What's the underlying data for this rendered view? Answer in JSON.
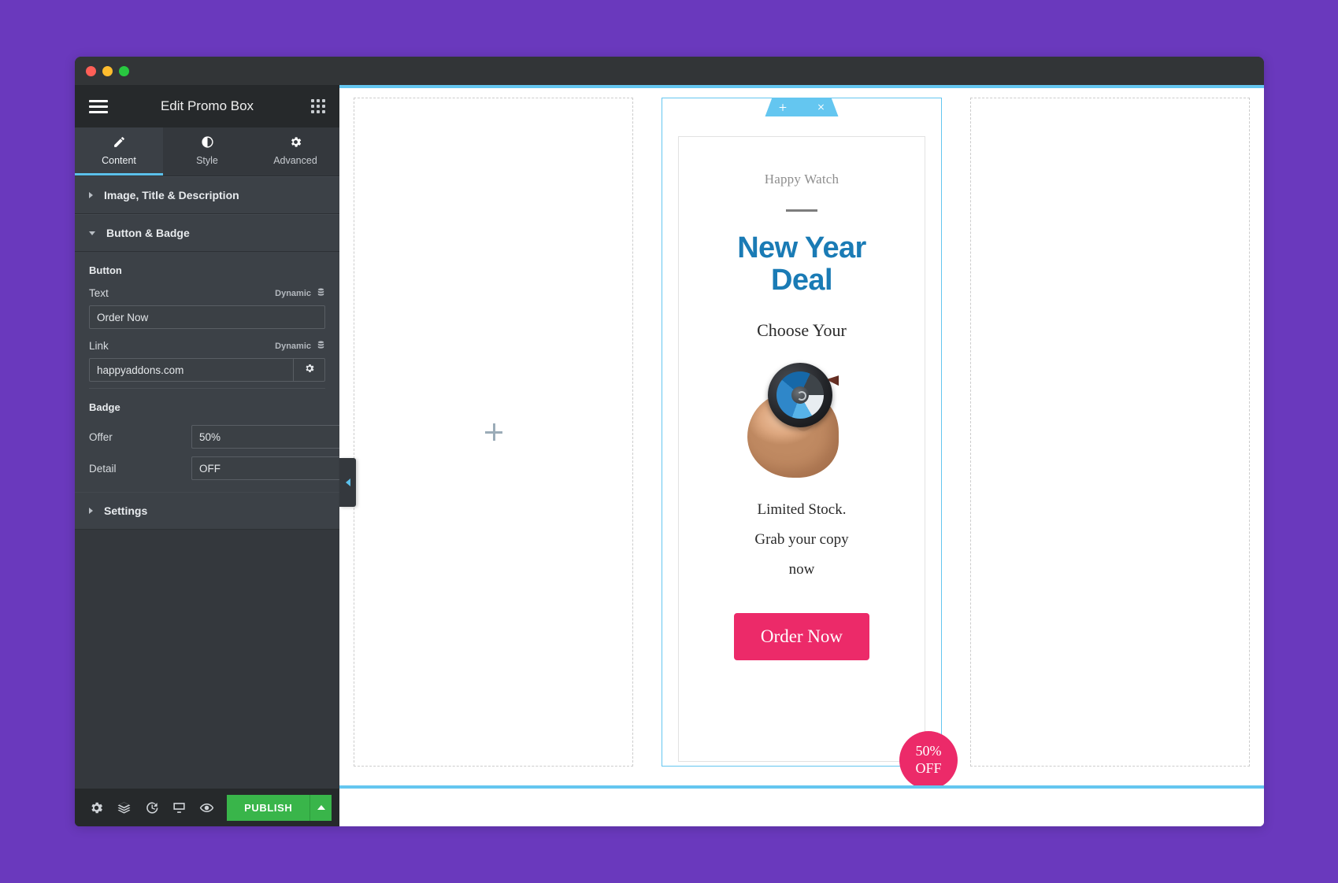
{
  "window": {
    "traffic_lights": [
      "close",
      "minimize",
      "maximize"
    ]
  },
  "panel": {
    "header": {
      "title": "Edit Promo Box",
      "menu_icon": "hamburger-icon",
      "apps_icon": "apps-grid-icon"
    },
    "tabs": [
      {
        "label": "Content",
        "icon": "pencil-icon",
        "active": true
      },
      {
        "label": "Style",
        "icon": "contrast-icon",
        "active": false
      },
      {
        "label": "Advanced",
        "icon": "gear-icon",
        "active": false
      }
    ],
    "sections": [
      {
        "label": "Image, Title & Description",
        "expanded": false
      },
      {
        "label": "Button & Badge",
        "expanded": true
      },
      {
        "label": "Settings",
        "expanded": false
      }
    ],
    "button_group": {
      "title": "Button",
      "text_label": "Text",
      "text_value": "Order Now",
      "text_dynamic_label": "Dynamic",
      "link_label": "Link",
      "link_value": "happyaddons.com",
      "link_dynamic_label": "Dynamic",
      "link_settings_icon": "gear-icon"
    },
    "badge_group": {
      "title": "Badge",
      "offer_label": "Offer",
      "offer_value": "50%",
      "detail_label": "Detail",
      "detail_value": "OFF"
    },
    "footer": {
      "icons": [
        "gear-icon",
        "layers-icon",
        "history-icon",
        "responsive-icon",
        "preview-icon"
      ],
      "publish_label": "PUBLISH",
      "publish_dropdown_icon": "chevron-up-icon",
      "publish_color": "#39b54a"
    },
    "collapse_handle_icon": "chevron-left-icon"
  },
  "canvas": {
    "add_widget_icon": "plus-icon",
    "widget_toolbar": {
      "add_icon": "plus-icon",
      "drag_icon": "dots-grid-icon",
      "close_icon": "close-icon",
      "color": "#64c6f0"
    },
    "promo_box": {
      "subtitle": "Happy Watch",
      "title_line1": "New Year",
      "title_line2": "Deal",
      "title_color": "#1a7bb5",
      "choose_text": "Choose Your",
      "image_alt": "hand-holding-smartwatch",
      "description_line1": "Limited Stock.",
      "description_line2": "Grab your copy",
      "description_line3": "now",
      "button_label": "Order Now",
      "button_color": "#ec2a69",
      "badge_offer": "50%",
      "badge_detail": "OFF",
      "badge_color": "#ec2a69"
    }
  }
}
